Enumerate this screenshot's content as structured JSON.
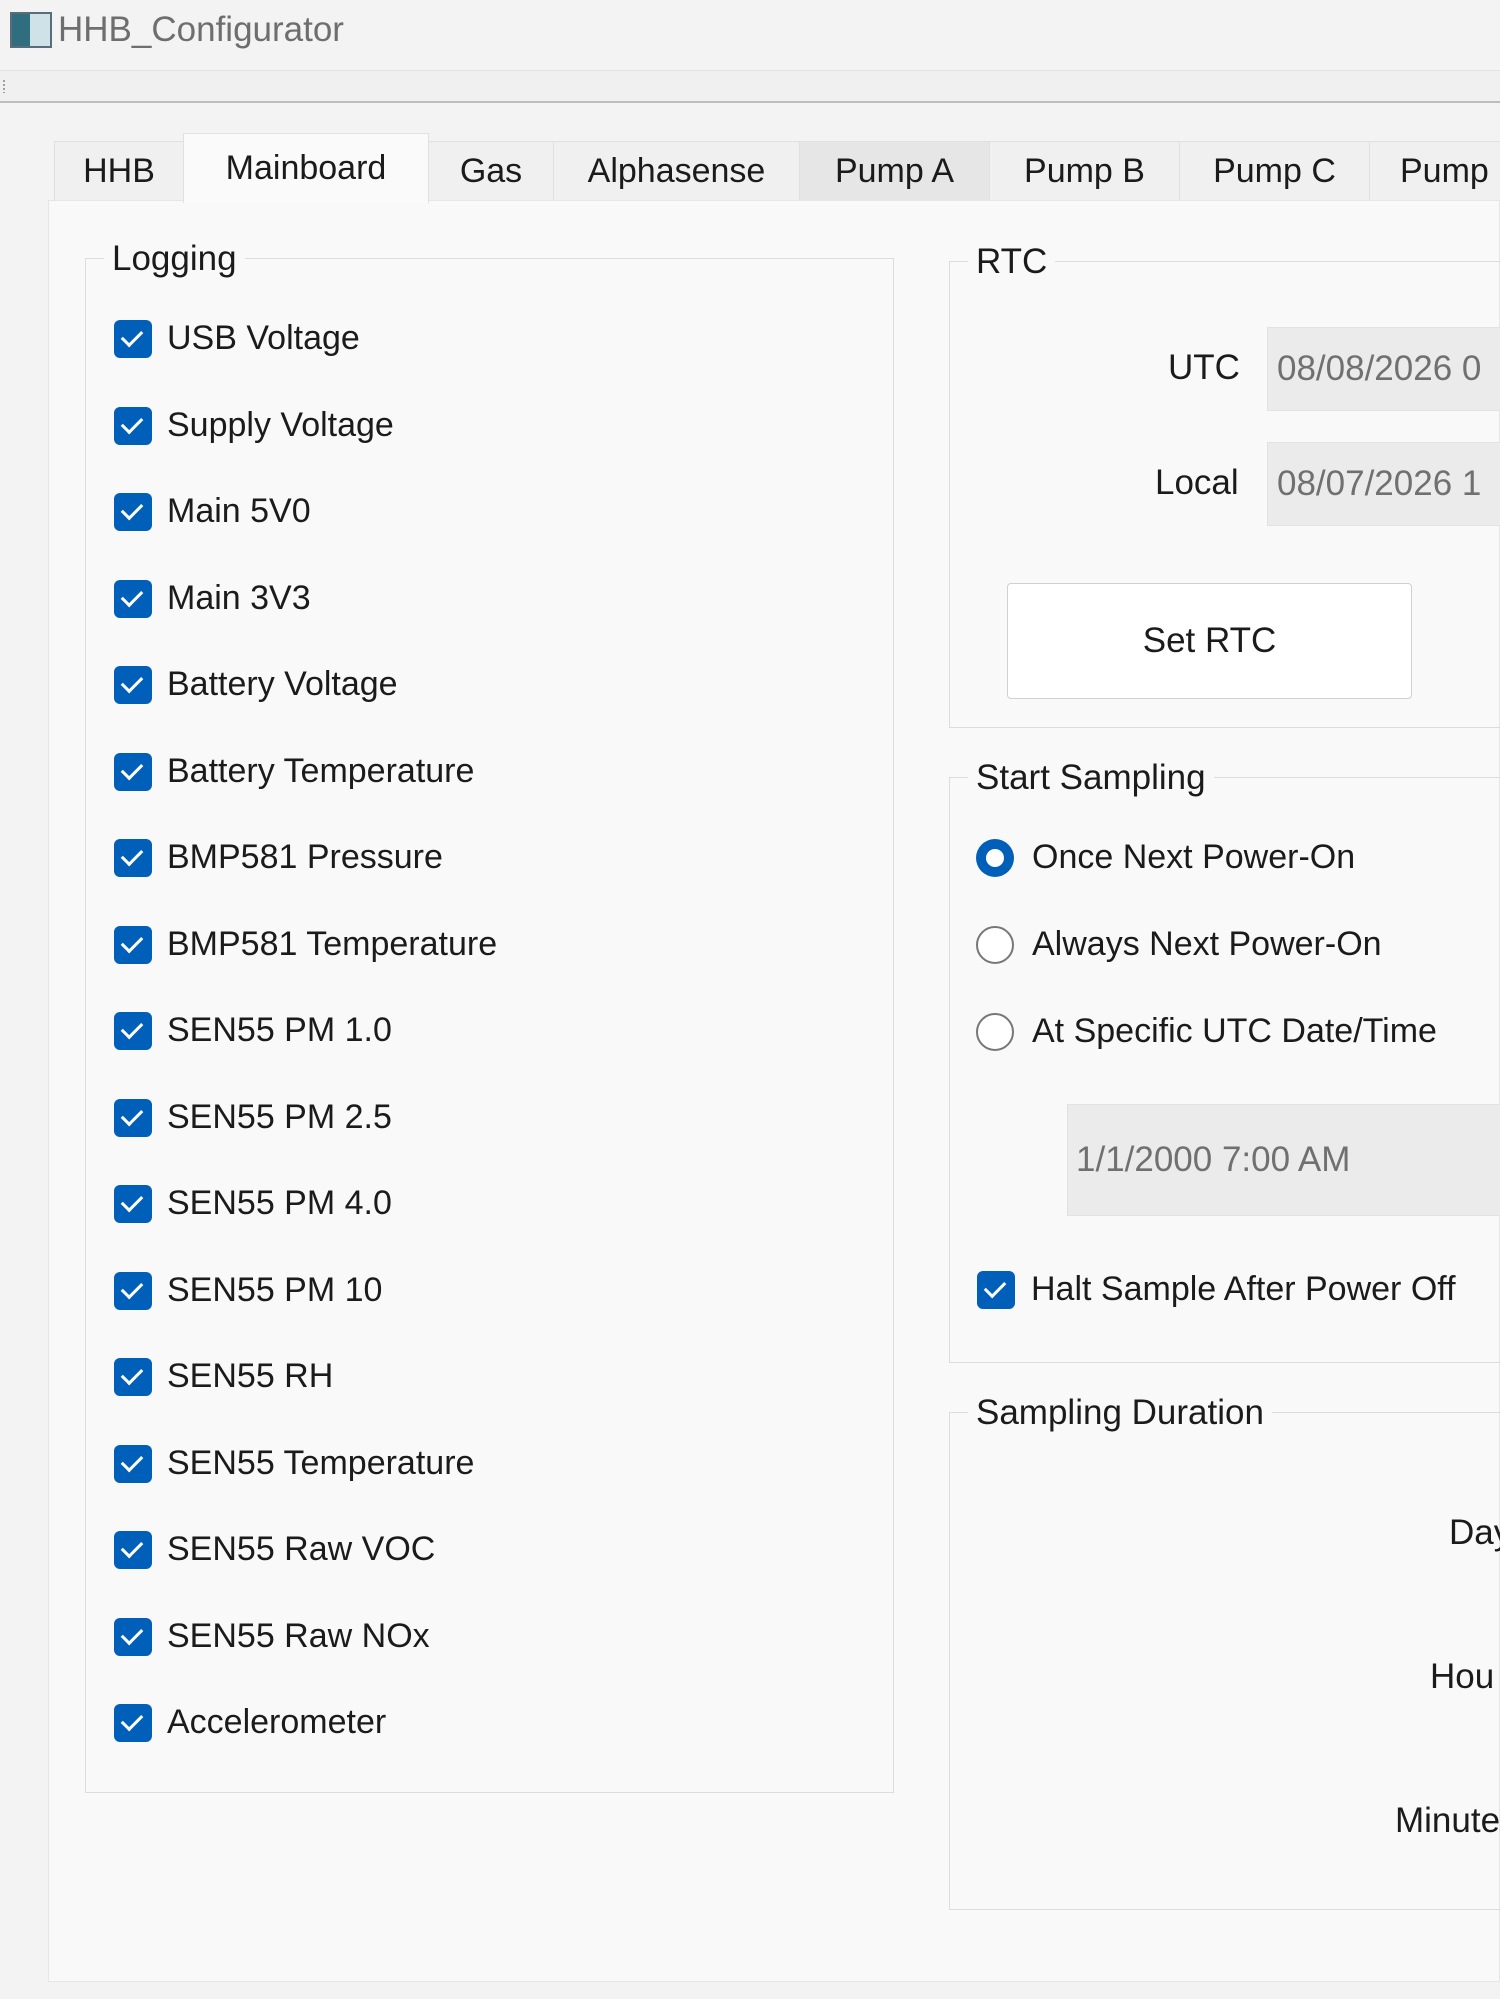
{
  "window": {
    "title": "HHB_Configurator"
  },
  "tabs": [
    "HHB",
    "Mainboard",
    "Gas",
    "Alphasense",
    "Pump A",
    "Pump B",
    "Pump C",
    "Pump"
  ],
  "active_tab": "Mainboard",
  "logging": {
    "title": "Logging",
    "items": [
      {
        "label": "USB Voltage",
        "checked": true
      },
      {
        "label": "Supply Voltage",
        "checked": true
      },
      {
        "label": "Main 5V0",
        "checked": true
      },
      {
        "label": "Main 3V3",
        "checked": true
      },
      {
        "label": "Battery Voltage",
        "checked": true
      },
      {
        "label": "Battery Temperature",
        "checked": true
      },
      {
        "label": "BMP581 Pressure",
        "checked": true
      },
      {
        "label": "BMP581 Temperature",
        "checked": true
      },
      {
        "label": "SEN55 PM 1.0",
        "checked": true
      },
      {
        "label": "SEN55 PM 2.5",
        "checked": true
      },
      {
        "label": "SEN55 PM 4.0",
        "checked": true
      },
      {
        "label": "SEN55 PM 10",
        "checked": true
      },
      {
        "label": "SEN55 RH",
        "checked": true
      },
      {
        "label": "SEN55 Temperature",
        "checked": true
      },
      {
        "label": "SEN55 Raw VOC",
        "checked": true
      },
      {
        "label": "SEN55 Raw NOx",
        "checked": true
      },
      {
        "label": "Accelerometer",
        "checked": true
      }
    ]
  },
  "rtc": {
    "title": "RTC",
    "utc_label": "UTC",
    "utc_value": "08/08/2026 0",
    "local_label": "Local",
    "local_value": "08/07/2026 1",
    "set_button": "Set RTC"
  },
  "start_sampling": {
    "title": "Start Sampling",
    "options": [
      {
        "label": "Once Next Power-On",
        "selected": true
      },
      {
        "label": "Always Next Power-On",
        "selected": false
      },
      {
        "label": "At Specific UTC Date/Time",
        "selected": false
      }
    ],
    "datetime_value": "1/1/2000 7:00 AM",
    "halt_label": "Halt Sample After Power Off",
    "halt_checked": true
  },
  "sampling_duration": {
    "title": "Sampling Duration",
    "days_label": "Day",
    "hours_label": "Hou",
    "minutes_label": "Minute"
  },
  "colors": {
    "accent": "#005fb8"
  }
}
